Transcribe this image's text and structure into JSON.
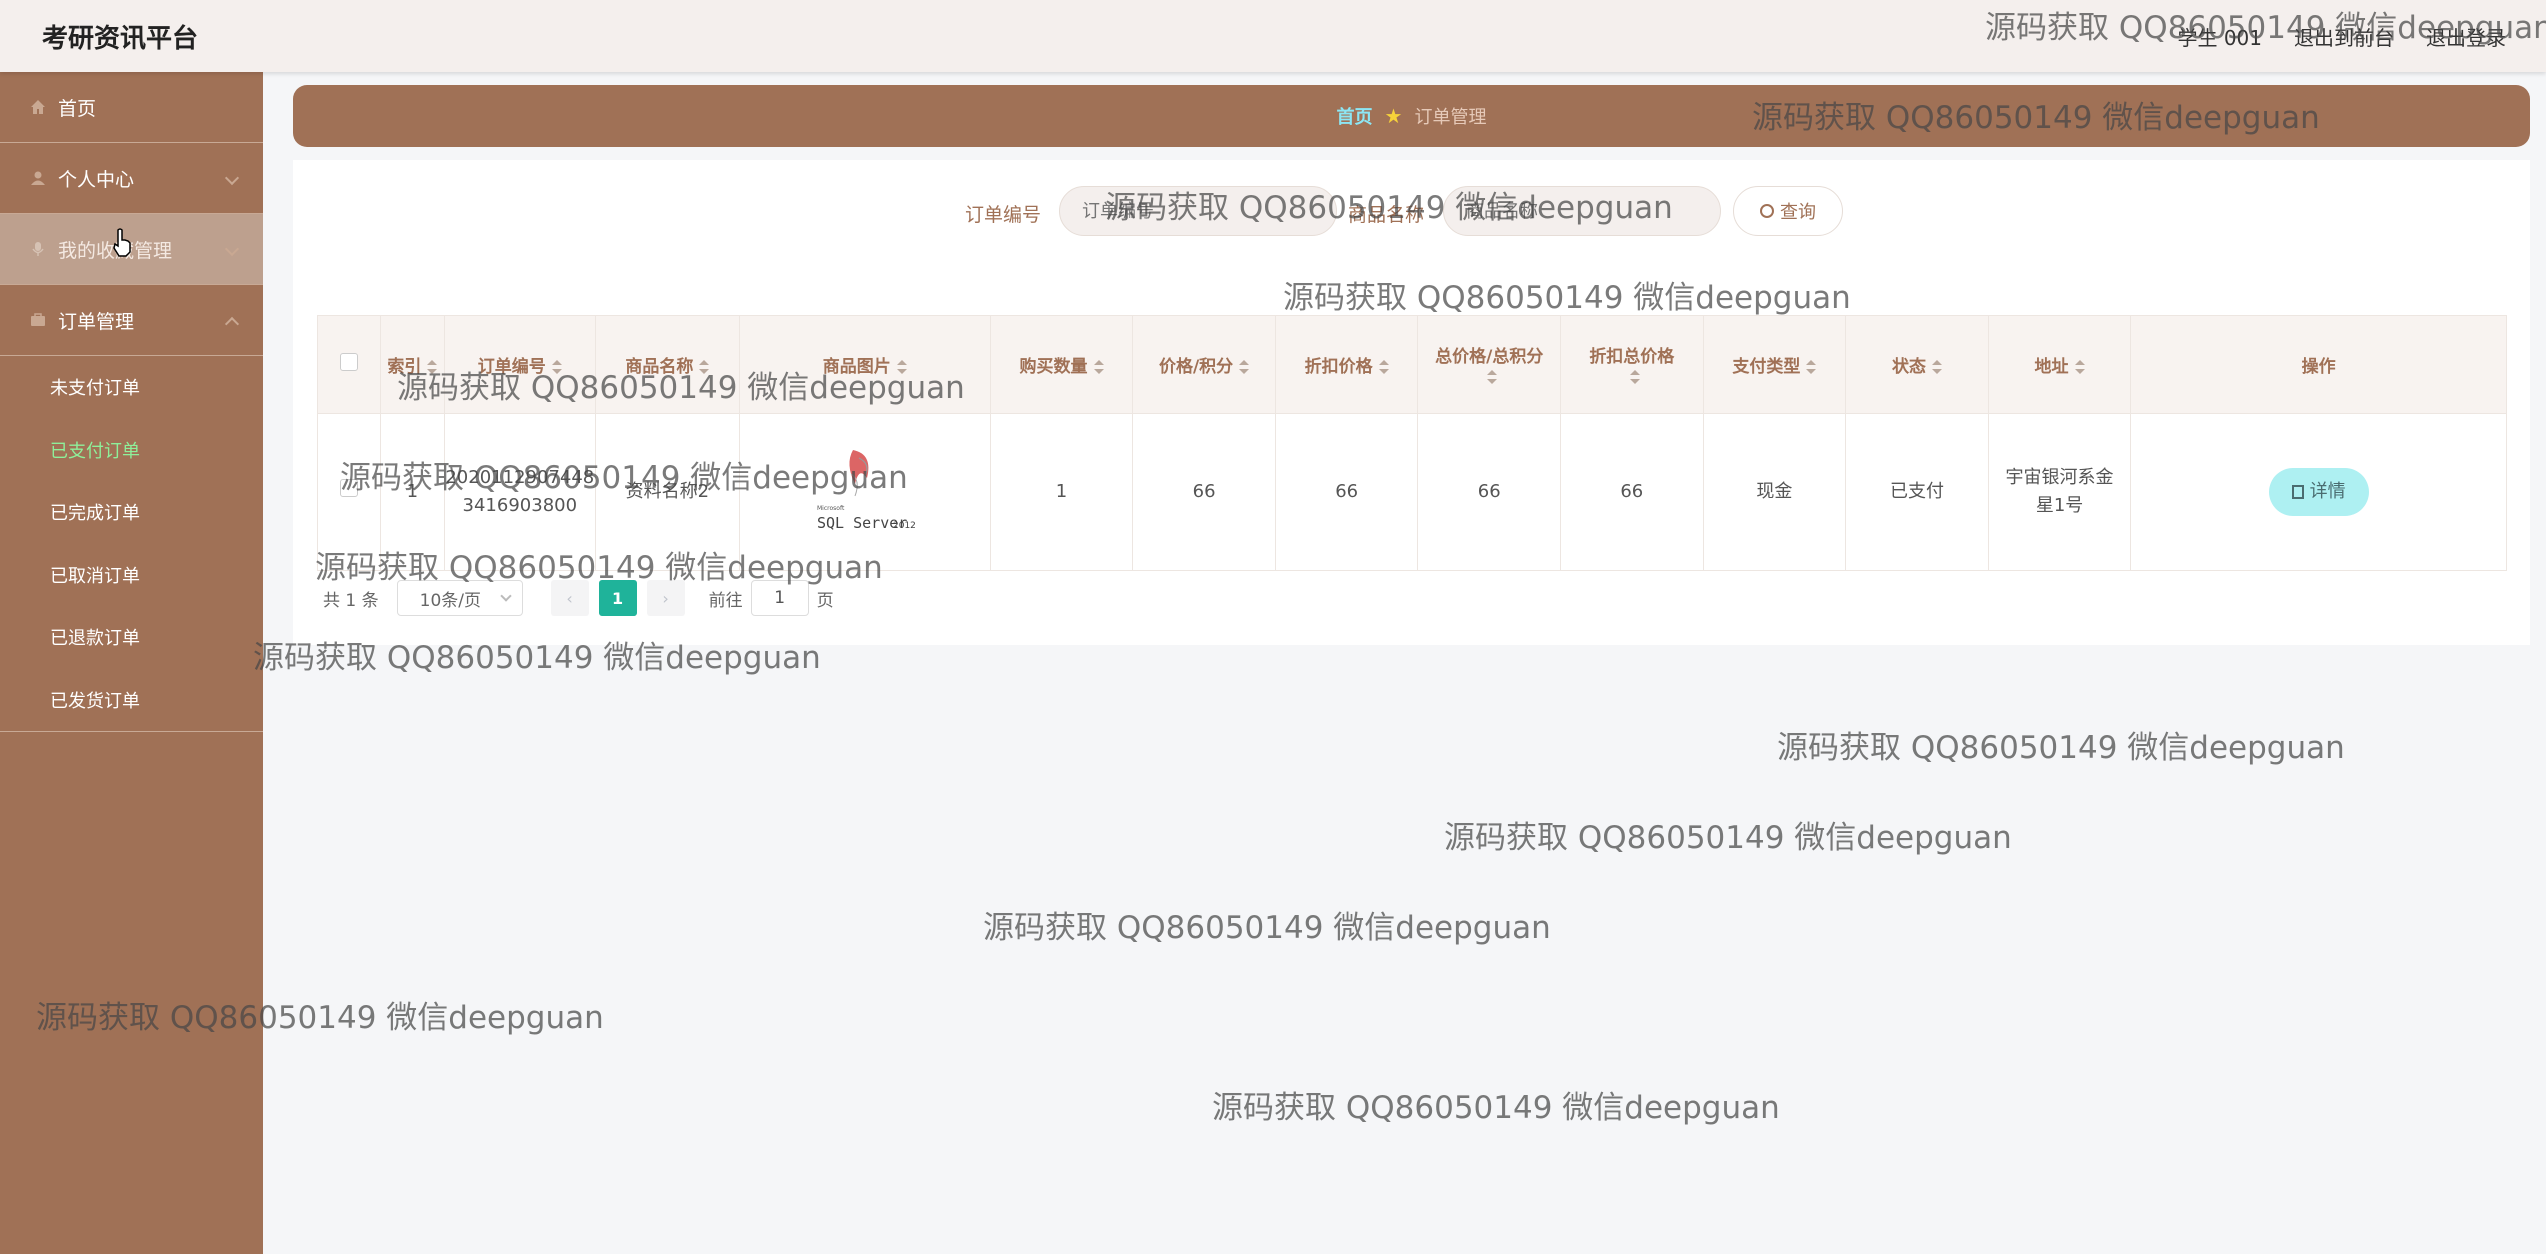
{
  "app": {
    "brand": "考研资讯平台"
  },
  "topbar": {
    "user": "学生 001",
    "front": "退出到前台",
    "logout": "退出登录"
  },
  "sidebar": {
    "items": [
      {
        "label": "首页"
      },
      {
        "label": "个人中心"
      },
      {
        "label": "我的收藏管理"
      },
      {
        "label": "订单管理"
      }
    ],
    "order_sub": [
      {
        "label": "未支付订单"
      },
      {
        "label": "已支付订单"
      },
      {
        "label": "已完成订单"
      },
      {
        "label": "已取消订单"
      },
      {
        "label": "已退款订单"
      },
      {
        "label": "已发货订单"
      }
    ]
  },
  "breadcrumb": {
    "home": "首页",
    "current": "订单管理"
  },
  "search": {
    "order_label": "订单编号",
    "order_placeholder": "订单编号",
    "name_label": "商品名称",
    "name_placeholder": "商品名称",
    "query": "查询"
  },
  "table": {
    "headers": [
      "索引",
      "订单编号",
      "商品名称",
      "商品图片",
      "购买数量",
      "价格/积分",
      "折扣价格",
      "总价格/总积分",
      "折扣总价格",
      "支付类型",
      "状态",
      "地址",
      "操作"
    ],
    "rows": [
      {
        "index": "1",
        "order_no": "20201129074483416903800",
        "order_no_line1": "2020112907448",
        "order_no_line2": "3416903800",
        "name": "资料名称2",
        "image_text_small": "Microsoft",
        "image_text": "SQL Server",
        "image_year": "2012",
        "qty": "1",
        "price": "66",
        "discount": "66",
        "total": "66",
        "discount_total": "66",
        "pay_type": "现金",
        "status": "已支付",
        "address_line1": "宇宙银河系金",
        "address_line2": "星1号",
        "action": "详情"
      }
    ]
  },
  "pager": {
    "total": "共 1 条",
    "page_size": "10条/页",
    "current": "1",
    "goto": "前往",
    "goto_value": "1",
    "page_unit": "页"
  },
  "watermark": "源码获取 QQ86050149 微信deepguan",
  "colors": {
    "brown": "#a07156",
    "active": "#8ef09a",
    "home_link": "#8ce6f4",
    "page_active": "#1fb39a"
  }
}
